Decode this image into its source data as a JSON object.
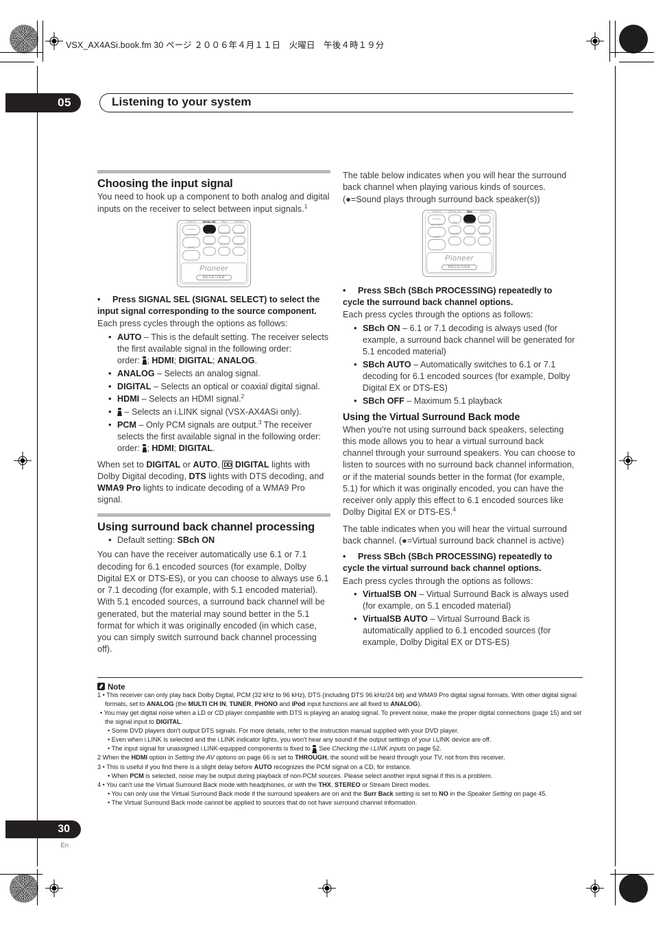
{
  "fileinfo": "VSX_AX4ASi.book.fm  30 ページ  ２００６年４月１１日　火曜日　午後４時１９分",
  "header": {
    "chapter_number": "05",
    "chapter_title": "Listening to your system"
  },
  "footer": {
    "page_number": "30",
    "language": "En"
  },
  "left": {
    "section_title": "Choosing the input signal",
    "intro": "You need to hook up a component to both analog and digital inputs on the receiver to select between input signals.",
    "intro_footnote": "1",
    "remote": {
      "name": "remote-signal-sel",
      "brand": "Pioneer",
      "mode_label": "RECEIVER",
      "highlight": "SIGNAL SEL",
      "keys_left": [
        "STATUS",
        "MULTI OPR",
        "SHIFT"
      ],
      "keys_grid": [
        [
          "SIGNAL SEL",
          "SBch",
          "STEREO"
        ],
        [
          "THX",
          "STANDARD",
          "ADV.SURR"
        ],
        [
          "PHASE",
          "MCACC",
          "S.DIRECT"
        ]
      ]
    },
    "lead_bullet": "Press SIGNAL SEL (SIGNAL SELECT) to select the input signal corresponding to the source component.",
    "lead_follow": "Each press cycles through the options as follows:",
    "options": [
      {
        "term": "AUTO",
        "desc": " – This is the default setting. The receiver selects the first available signal in the following order: "
      },
      {
        "term": "ANALOG",
        "desc": " – Selects an analog signal."
      },
      {
        "term": "DIGITAL",
        "desc": " – Selects an optical or coaxial digital signal."
      },
      {
        "term": "HDMI",
        "desc": " – Selects an HDMI signal.",
        "sup": "2"
      },
      {
        "term": "",
        "desc": " – Selects an i.LINK signal (VSX-AX4ASi only)."
      },
      {
        "term": "PCM",
        "desc": " – Only PCM signals are output.",
        "sup": "3",
        "desc2": " The receiver selects the first available signal in the following order: "
      }
    ],
    "order_auto": {
      "sep1": "; ",
      "hdmi": "HDMI",
      "sep2": "; ",
      "digital": "DIGITAL",
      "sep3": "; ",
      "analog": "ANALOG",
      "end": "."
    },
    "order_pcm": {
      "sep1": "; ",
      "hdmi": "HDMI",
      "sep2": "; ",
      "digital": "DIGITAL",
      "end": "."
    },
    "order_prefix": "order: ",
    "closing": {
      "p1": "When set to ",
      "b1": "DIGITAL",
      "p2": " or ",
      "b2": "AUTO",
      "p3": ", ",
      "dd": "DD",
      "b3": " DIGITAL",
      "p4": " lights with Dolby Digital decoding, ",
      "b4": "DTS",
      "p5": " lights with DTS decoding, and ",
      "b5": "WMA9 Pro",
      "p6": " lights to indicate decoding of a WMA9 Pro signal."
    },
    "section2_title": "Using surround back channel processing",
    "section2_default_label": "Default setting: ",
    "section2_default_value": "SBch ON",
    "section2_body": "You can have the receiver automatically use 6.1 or 7.1 decoding for 6.1 encoded sources (for example, Dolby Digital EX or DTS-ES), or you can choose to always use 6.1 or 7.1 decoding (for example, with 5.1 encoded material). With 5.1 encoded sources, a surround back channel will be generated, but the material may sound better in the 5.1 format for which it was originally encoded (in which case, you can simply switch surround back channel processing off)."
  },
  "right": {
    "table_intro_a": "The table below indicates when you will hear the surround back channel when playing various kinds of sources. (",
    "table_intro_b": "=Sound plays through surround back speaker(s))",
    "remote": {
      "name": "remote-sbch",
      "brand": "Pioneer",
      "mode_label": "RECEIVER",
      "highlight": "SBch",
      "keys_left": [
        "STATUS",
        "MULTI OPR",
        "SHIFT"
      ],
      "keys_grid": [
        [
          "SIGNAL SEL",
          "SBch",
          "STEREO"
        ],
        [
          "THX",
          "STANDARD",
          "ADV.SURR"
        ],
        [
          "PHASE",
          "MCACC",
          "S.DIRECT"
        ]
      ]
    },
    "lead_bullet": "Press SBch (SBch PROCESSING) repeatedly to cycle the surround back channel options.",
    "lead_follow": "Each press cycles through the options as follows:",
    "options": [
      {
        "term": "SBch ON",
        "desc": " – 6.1 or 7.1 decoding is always used (for example, a surround back channel will be generated for 5.1 encoded material)"
      },
      {
        "term": "SBch AUTO",
        "desc": " – Automatically switches to 6.1 or 7.1 decoding for 6.1 encoded sources (for example, Dolby Digital EX or DTS-ES)"
      },
      {
        "term": "SBch OFF",
        "desc": " – Maximum 5.1 playback"
      }
    ],
    "section2_title": "Using the Virtual Surround Back mode",
    "section2_body": "When you're not using surround back speakers, selecting this mode allows you to hear a virtual surround back channel through your surround speakers. You can choose to listen to sources with no surround back channel information, or if the material sounds better in the format (for example, 5.1) for which it was originally encoded, you can have the receiver only apply this effect to 6.1 encoded sources like Dolby Digital EX or DTS-ES.",
    "section2_footnote": "4",
    "table_intro2_a": "The table indicates when you will hear the virtual surround back channel. (",
    "table_intro2_b": "=Virtual surround back channel is active)",
    "lead_bullet2": "Press SBch (SBch PROCESSING) repeatedly to cycle the virtual surround back channel options.",
    "lead_follow2": "Each press cycles through the options as follows:",
    "options2": [
      {
        "term": "VirtualSB ON",
        "desc": " – Virtual Surround Back is always used (for example, on 5.1 encoded material)"
      },
      {
        "term": "VirtualSB AUTO",
        "desc": " – Virtual Surround Back is automatically applied to 6.1 encoded sources (for example, Dolby Digital EX or DTS-ES)"
      }
    ]
  },
  "notes": {
    "title": "Note",
    "n1a_pre": "1 • This receiver can only play back Dolby Digital, PCM (32 kHz to 96 kHz), DTS (including DTS 96 kHz/24 bit) and WMA9 Pro digital signal formats. With other digital signal formats, set to ",
    "n1a_b1": "ANALOG",
    "n1a_m1": " (the ",
    "n1a_b2": "MULTI CH IN",
    "n1a_m2": ", ",
    "n1a_b3": "TUNER",
    "n1a_m3": ", ",
    "n1a_b4": "PHONO",
    "n1a_m4": " and ",
    "n1a_b5": "iPod",
    "n1a_m5": " input functions are all fixed to ",
    "n1a_b6": "ANALOG",
    "n1a_end": ").",
    "n1b_pre": "• You may get digital noise when a LD or CD player compatible with DTS is playing an analog signal. To prevent noise, make the proper digital connections (page 15) and set the signal input to ",
    "n1b_b1": "DIGITAL",
    "n1b_end": ".",
    "n1c": "• Some DVD players don't output DTS signals. For more details, refer to the instruction manual supplied with your DVD player.",
    "n1d": "• Even when i.LINK is selected and the i.LINK indicator lights, you won't hear any sound if the output settings of your i.LINK device are off.",
    "n1e_pre": "• The input signal for unassigned i.LINK-equipped components is fixed to ",
    "n1e_mid": ". See ",
    "n1e_it": "Checking the i.LINK inputs",
    "n1e_end": " on page 52.",
    "n2_pre": "2 When the ",
    "n2_b1": "HDMI",
    "n2_m1": " option in ",
    "n2_it": "Setting the AV options",
    "n2_m2": " on page 66 is set to ",
    "n2_b2": "THROUGH",
    "n2_end": ", the sound will be heard through your TV, not from this receiver.",
    "n3a_pre": "3 • This is useful if you find there is a slight delay before ",
    "n3a_b1": "AUTO",
    "n3a_end": " recognizes the PCM signal on a CD, for instance.",
    "n3b_pre": "• When ",
    "n3b_b1": "PCM",
    "n3b_end": " is selected, noise may be output during playback of non-PCM sources. Please select another input signal if this is a problem.",
    "n4a_pre": "4 • You can't use the Virtual Surround Back mode with headphones, or with the ",
    "n4a_b1": "THX",
    "n4a_m1": ", ",
    "n4a_b2": "STEREO",
    "n4a_end": " or Stream Direct modes.",
    "n4b_pre": "• You can only use the Virtual Surround Back mode if the surround speakers are on and the ",
    "n4b_b1": "Surr Back",
    "n4b_m1": " setting is set to ",
    "n4b_b2": "NO",
    "n4b_m2": " in the ",
    "n4b_it": "Speaker Setting",
    "n4b_end": " on page 45.",
    "n4c": "• The Virtual Surround Back mode cannot be applied to sources that do not have surround channel information."
  },
  "colors": {
    "ink": "#231f20",
    "body_text": "#3a3a3c",
    "rule_gray": "#b6b8ba"
  }
}
